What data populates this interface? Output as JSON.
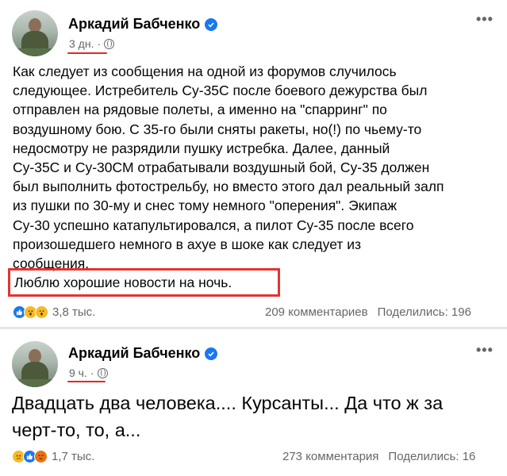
{
  "post1": {
    "author": "Аркадий Бабченко",
    "time": "3 дн.",
    "separator": "·",
    "more_icon": "•••",
    "body_lines": [
      "Как следует из сообщения на одной из форумов случилось",
      "следующее. Истребитель Су-35С после боевого дежурства был",
      "отправлен на рядовые полеты, а именно на \"спарринг\" по",
      "воздушному бою. С 35-го были сняты ракеты, но(!) по чьему-то",
      "недосмотру не разрядили пушку истребка. Далее, данный",
      "Су-35С и Су-30СМ отрабатывали воздушный бой, Су-35 должен",
      "был выполнить фотострельбу, но вместо этого дал реальный залп",
      "из пушки по 30-му и снес тому немного \"оперения\". Экипаж",
      "Су-30 успешно катапультировался, а пилот Су-35 после всего",
      "произошедшего немного в ахуе в шоке как следует из",
      "сообщения."
    ],
    "highlight": "Люблю хорошие новости на ночь.",
    "reactions_count": "3,8 тыс.",
    "comments": "209 комментариев",
    "shares": "Поделились: 196",
    "reaction_icons": [
      "like",
      "wow",
      "wow"
    ]
  },
  "post2": {
    "author": "Аркадий Бабченко",
    "time": "9 ч.",
    "separator": "·",
    "more_icon": "•••",
    "body_lines": [
      "Двадцать два человека.... Курсанты... Да что ж за",
      "черт-то, то, а..."
    ],
    "reactions_count": "1,7 тыс.",
    "comments": "273 комментария",
    "shares": "Поделились: 16",
    "reaction_icons": [
      "sad",
      "like",
      "angry"
    ]
  },
  "colors": {
    "highlight_border": "#e3342f",
    "underline": "#e5281f",
    "verified": "#1877f2",
    "meta_text": "#65676b"
  }
}
